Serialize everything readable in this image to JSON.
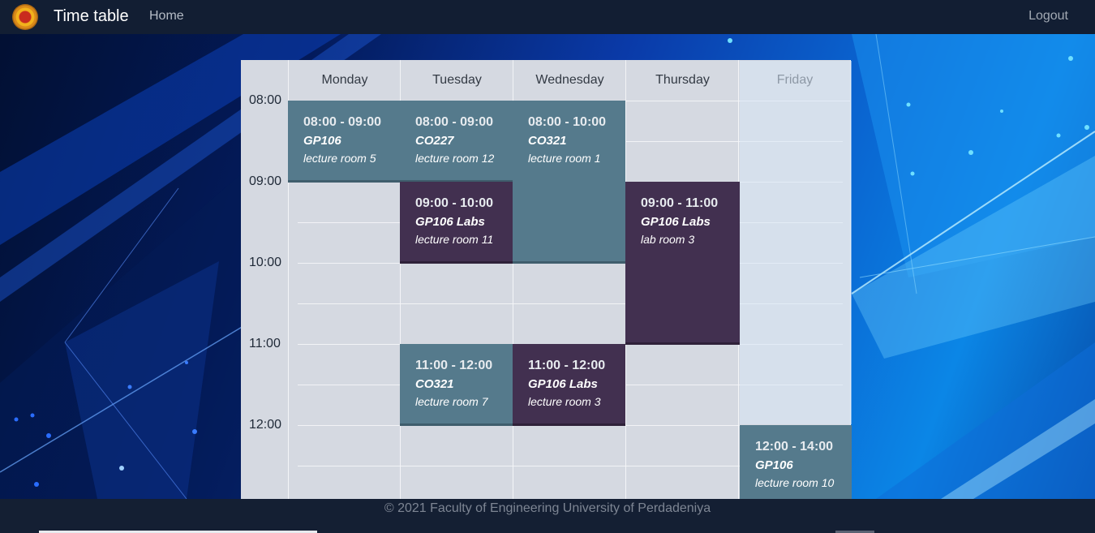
{
  "navbar": {
    "brand": "Time table",
    "home": "Home",
    "logout": "Logout"
  },
  "timetable": {
    "days": [
      "Monday",
      "Tuesday",
      "Wednesday",
      "Thursday",
      "Friday"
    ],
    "times": [
      "08:00",
      "09:00",
      "10:00",
      "11:00",
      "12:00"
    ],
    "events": [
      {
        "day": "Monday",
        "time": "08:00 - 09:00",
        "course": "GP106",
        "room": "lecture room 5",
        "color": "#557a8c"
      },
      {
        "day": "Tuesday",
        "time": "08:00 - 09:00",
        "course": "CO227",
        "room": "lecture room 12",
        "color": "#557a8c"
      },
      {
        "day": "Wednesday",
        "time": "08:00 - 10:00",
        "course": "CO321",
        "room": "lecture room 1",
        "color": "#557a8c"
      },
      {
        "day": "Tuesday",
        "time": "09:00 - 10:00",
        "course": "GP106 Labs",
        "room": "lecture room 11",
        "color": "#423050"
      },
      {
        "day": "Thursday",
        "time": "09:00 - 11:00",
        "course": "GP106 Labs",
        "room": "lab room 3",
        "color": "#423050"
      },
      {
        "day": "Tuesday",
        "time": "11:00 - 12:00",
        "course": "CO321",
        "room": "lecture room 7",
        "color": "#557a8c"
      },
      {
        "day": "Wednesday",
        "time": "11:00 - 12:00",
        "course": "GP106 Labs",
        "room": "lecture room 3",
        "color": "#423050"
      },
      {
        "day": "Friday",
        "time": "12:00 - 14:00",
        "course": "GP106",
        "room": "lecture room 10",
        "color": "#557a8c"
      }
    ]
  },
  "footer": {
    "text": "© 2021 Faculty of Engineering University of Perdadeniya"
  }
}
